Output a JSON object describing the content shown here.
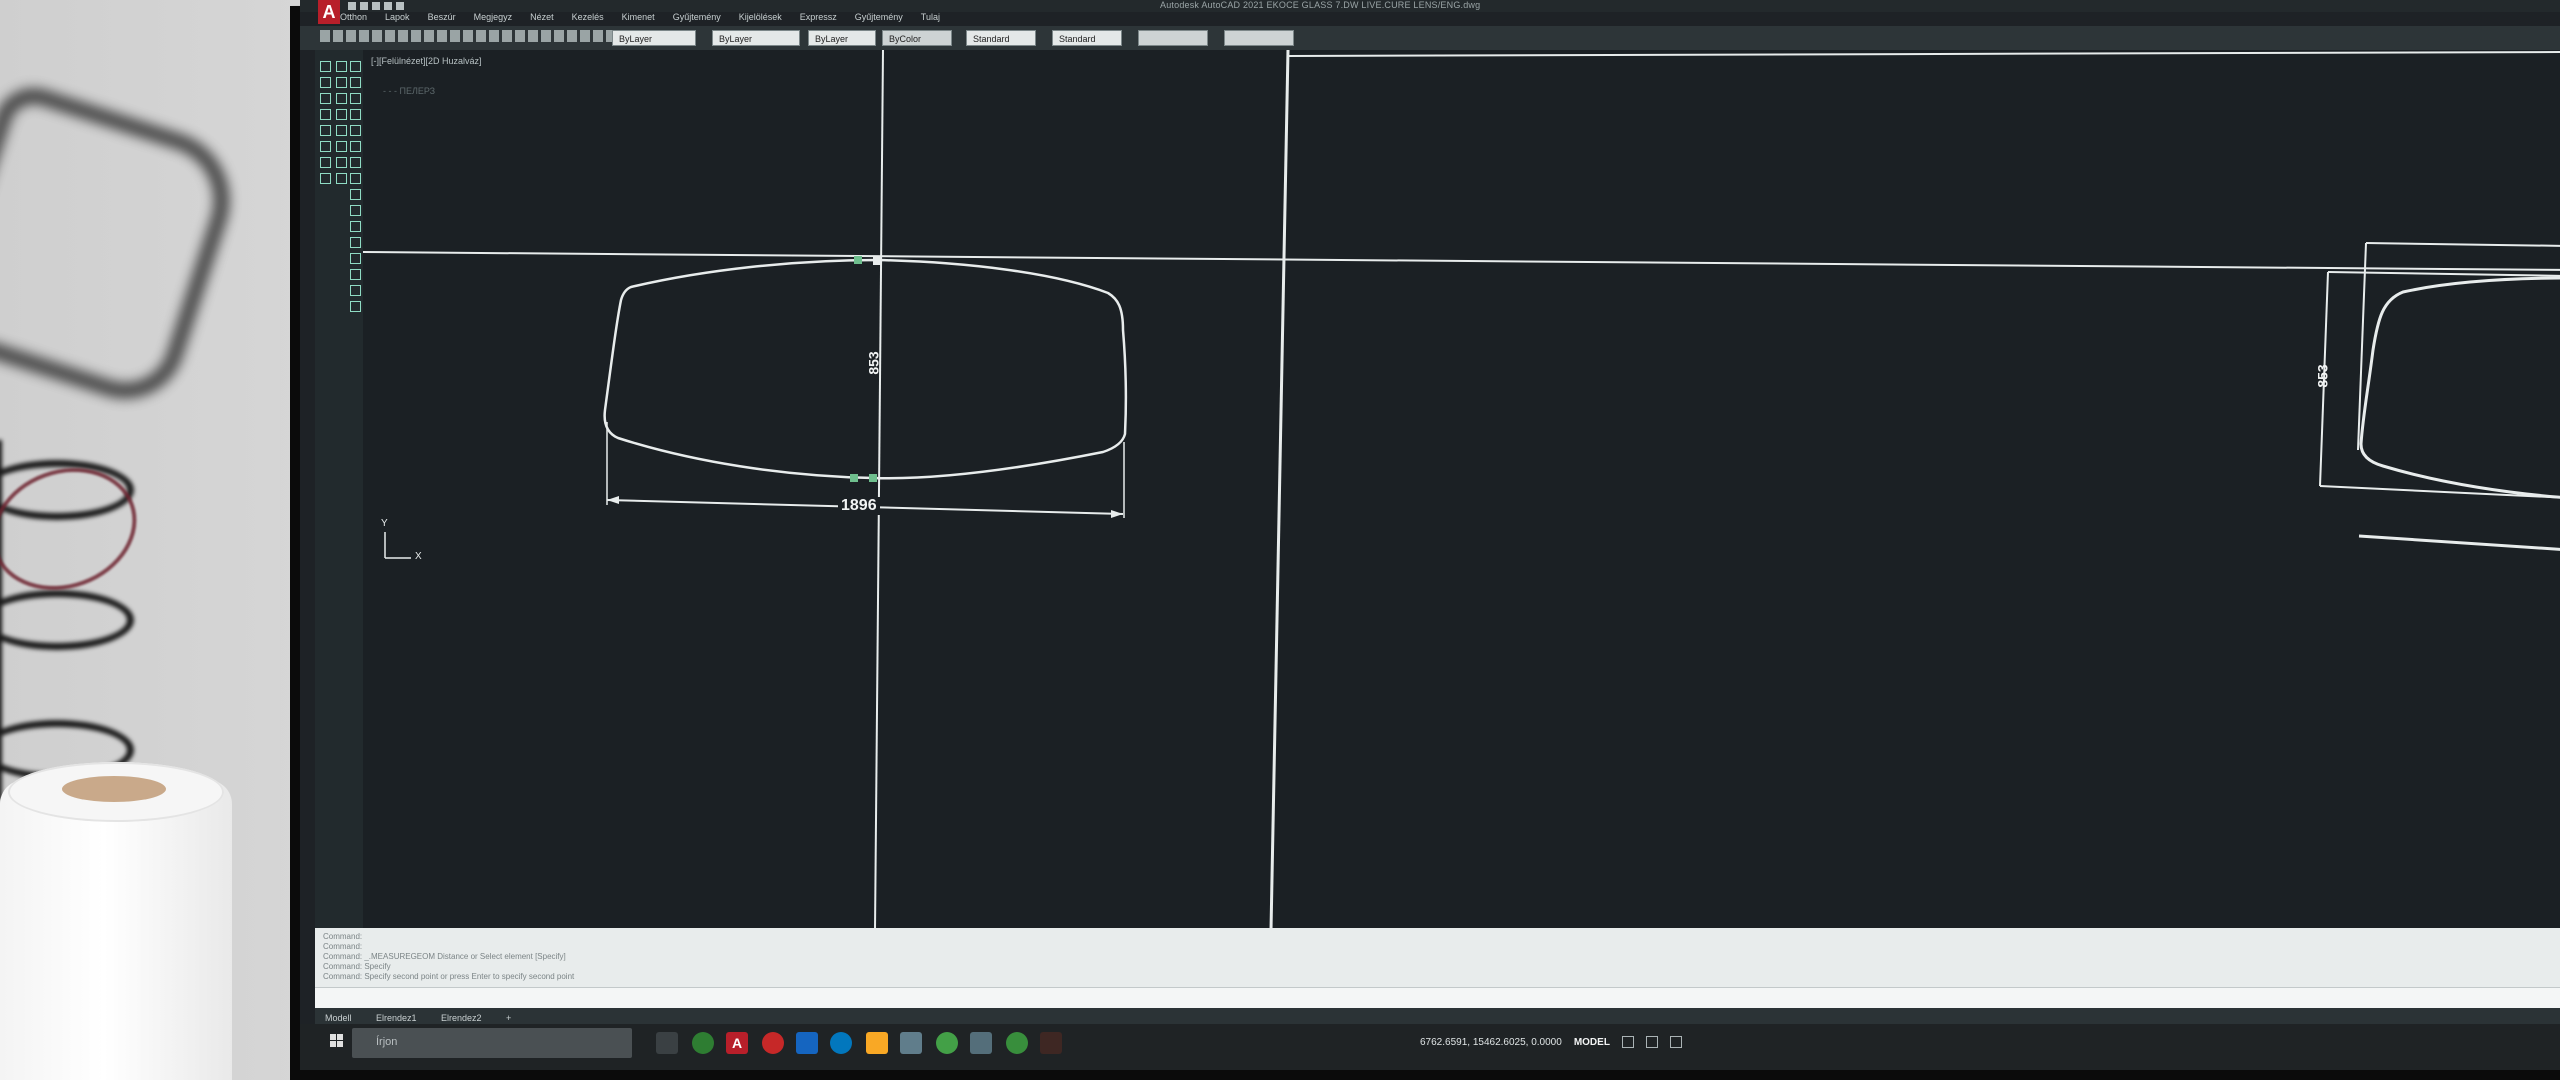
{
  "window": {
    "title": "Autodesk AutoCAD 2021   EKOCE   GLASS 7.DW LIVE.CURE LENS/ENG.dwg",
    "app_icon_label": "A"
  },
  "menu": {
    "items": [
      "Otthon",
      "Lapok",
      "Beszúr",
      "Megjegyz",
      "Nézet",
      "Kezelés",
      "Kimenet",
      "Gyűjtemény",
      "Kijelölések",
      "Expressz",
      "Gyűjtemény",
      "Tulaj"
    ]
  },
  "properties": {
    "layer": "ByLayer",
    "linetype": "ByLayer",
    "lineweight": "ByLayer",
    "color": "ByColor",
    "text_style": "Standard",
    "dim_style": "Standard",
    "extra1": "",
    "extra2": ""
  },
  "viewport": {
    "label": "[-][Felülnézet][2D Huzalváz]",
    "sublabel": "- - -  ПЕЛЕРЗ"
  },
  "drawing": {
    "dim_width": "1896",
    "dim_height": "853",
    "dim_height_right": "853",
    "ucs_y": "Y",
    "ucs_x": "X"
  },
  "command": {
    "history": "Command:\nCommand:\nCommand: _.MEASUREGEOM Distance or Select element [Specify]\nCommand: Specify\nCommand: Specify second point or press Enter to specify second point"
  },
  "layout_tabs": [
    "Modell",
    "Elrendez1",
    "Elrendez2",
    "+"
  ],
  "taskbar": {
    "search_placeholder": "Írjon"
  },
  "status": {
    "coords": "6762.6591, 15462.6025, 0.0000",
    "mode": "MODEL"
  },
  "colors": {
    "viewport_bg": "#1b2024",
    "geometry": "#e8ecec",
    "accent_teal": "#8fdcc4",
    "autocad_red": "#b81f2a"
  }
}
